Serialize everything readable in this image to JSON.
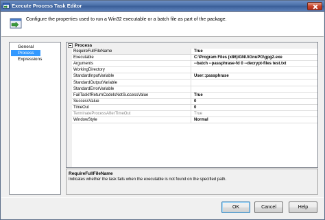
{
  "window": {
    "title": "Execute Process Task Editor"
  },
  "header": {
    "description": "Configure the properties used to run a Win32 executable or a batch file as part of the package."
  },
  "nav": {
    "items": [
      {
        "label": "General",
        "selected": false
      },
      {
        "label": "Process",
        "selected": true
      },
      {
        "label": "Expressions",
        "selected": false
      }
    ]
  },
  "grid": {
    "category": "Process",
    "rows": [
      {
        "name": "RequireFullFileName",
        "value": "True"
      },
      {
        "name": "Executable",
        "value": "C:\\Program Files (x86)\\GNU\\GnuPG\\gpg2.exe"
      },
      {
        "name": "Arguments",
        "value": "--batch --passphrase-fd 0 --decrypt-files test.txt"
      },
      {
        "name": "WorkingDirectory",
        "value": ""
      },
      {
        "name": "StandardInputVariable",
        "value": "User::passphrase"
      },
      {
        "name": "StandardOutputVariable",
        "value": ""
      },
      {
        "name": "StandardErrorVariable",
        "value": ""
      },
      {
        "name": "FailTaskIfReturnCodeIsNotSuccessValue",
        "value": "True"
      },
      {
        "name": "SuccessValue",
        "value": "0"
      },
      {
        "name": "TimeOut",
        "value": "0"
      },
      {
        "name": "TerminateProcessAfterTimeOut",
        "value": "True"
      },
      {
        "name": "WindowStyle",
        "value": "Normal"
      }
    ]
  },
  "description_panel": {
    "title": "RequireFullFileName",
    "text": "Indicates whether the task fails when the executable is not found on the specified path."
  },
  "buttons": {
    "ok": "OK",
    "cancel": "Cancel",
    "help": "Help"
  },
  "colors": {
    "title_bar": "#4a6fa8",
    "selection": "#3399ff",
    "close_button": "#c7452a"
  },
  "icons": {
    "title": "execute-process-icon",
    "header": "execute-process-icon",
    "close": "close-icon",
    "expand": "collapse-minus-icon"
  }
}
